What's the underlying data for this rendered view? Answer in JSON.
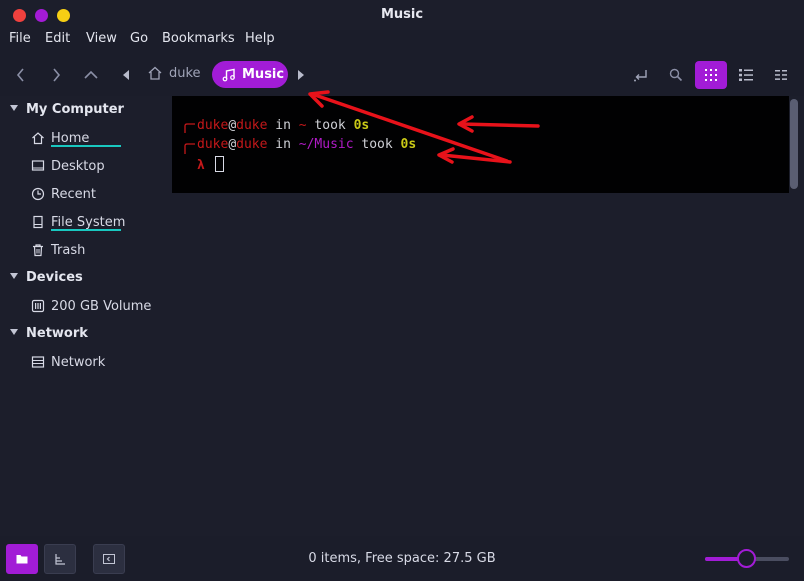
{
  "window": {
    "title": "Music"
  },
  "menubar": {
    "items": [
      "File",
      "Edit",
      "View",
      "Go",
      "Bookmarks",
      "Help"
    ]
  },
  "toolbar": {
    "breadcrumb": [
      {
        "label": "duke",
        "icon": "home-icon"
      },
      {
        "label": "Music",
        "icon": "music-note-icon",
        "active": true
      }
    ],
    "accent": "#a21cd6"
  },
  "sidebar": {
    "sections": [
      {
        "title": "My Computer",
        "items": [
          {
            "label": "Home",
            "icon": "home-icon"
          },
          {
            "label": "Desktop",
            "icon": "desktop-icon"
          },
          {
            "label": "Recent",
            "icon": "clock-icon"
          },
          {
            "label": "File System",
            "icon": "drive-icon"
          },
          {
            "label": "Trash",
            "icon": "trash-icon"
          }
        ]
      },
      {
        "title": "Devices",
        "items": [
          {
            "label": "200 GB Volume",
            "icon": "volume-icon"
          }
        ]
      },
      {
        "title": "Network",
        "items": [
          {
            "label": "Network",
            "icon": "network-icon"
          }
        ]
      }
    ]
  },
  "terminal": {
    "lines": [
      {
        "user": "duke",
        "at": "@",
        "host": "duke",
        "in": " in ",
        "dir": "~",
        "took": " took ",
        "time": "0s"
      },
      {
        "user": "duke",
        "at": "@",
        "host": "duke",
        "in": " in ",
        "dir": "~/Music",
        "took": " took ",
        "time": "0s"
      }
    ],
    "prompt": "λ",
    "colors": {
      "user": "#c4181a",
      "dir_home": "#c4181a",
      "dir_path": "#b11bc7",
      "time": "#c9c916",
      "text": "#cfd0d6"
    }
  },
  "status": {
    "text": "0 items, Free space: 27.5 GB",
    "zoom_fraction": 0.5
  },
  "annotation_color": "#e8121a"
}
